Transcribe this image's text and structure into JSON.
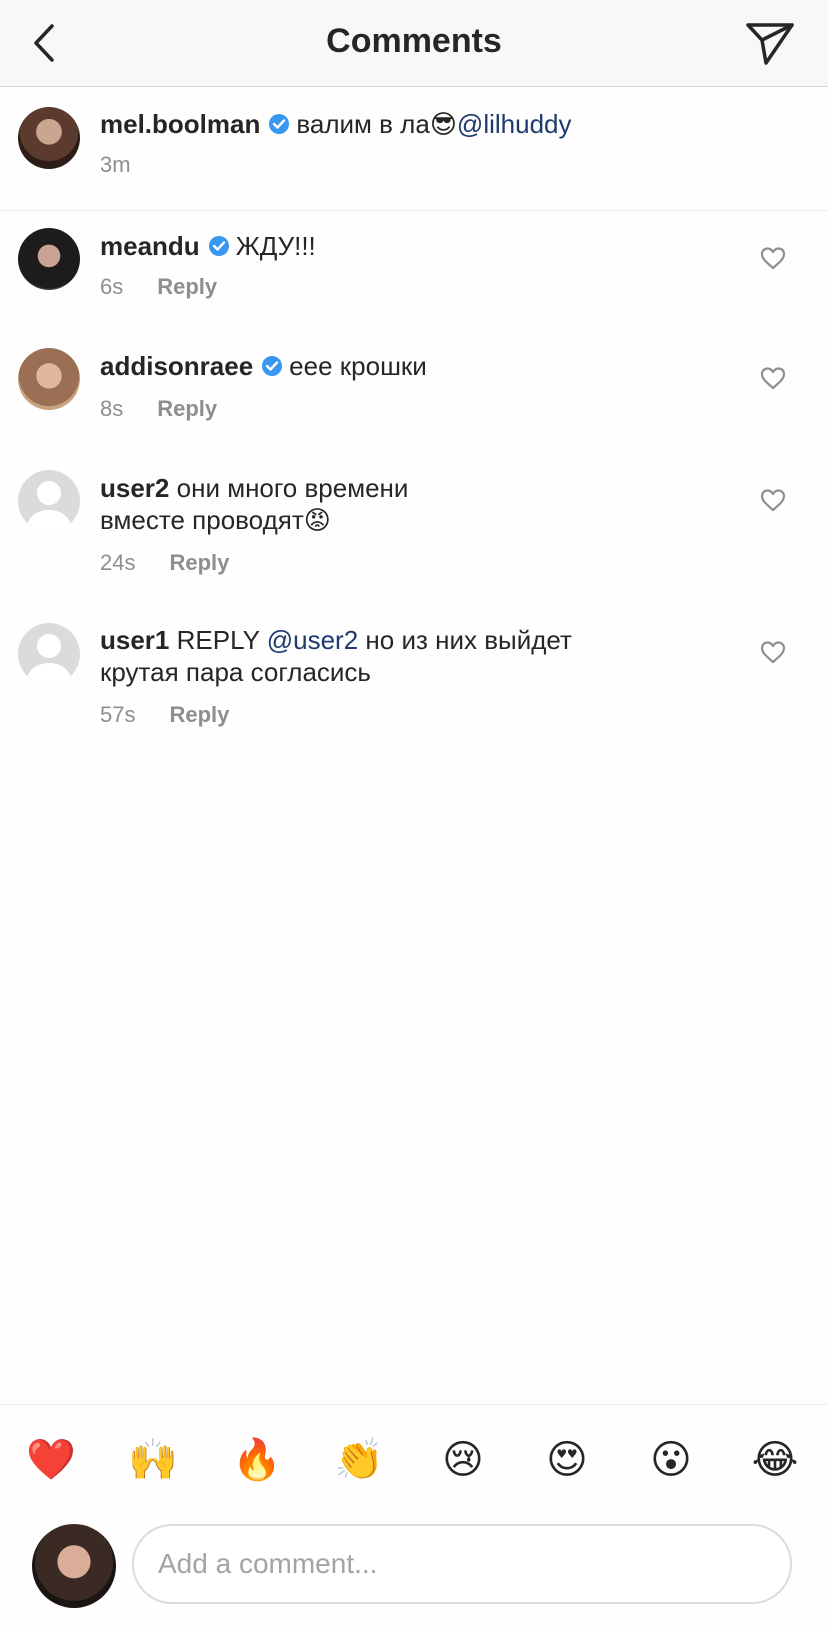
{
  "header": {
    "title": "Comments"
  },
  "caption": {
    "username": "mel.boolman",
    "text": "валим в ла",
    "emoji": "😎",
    "mention": "@lilhuddy",
    "time": "3m"
  },
  "comments": [
    {
      "username": "meandu",
      "verified": true,
      "text": "ЖДУ!!!",
      "time": "6s",
      "reply_label": "Reply"
    },
    {
      "username": "addisonraee",
      "verified": true,
      "text": "еее крошки",
      "time": "8s",
      "reply_label": "Reply"
    },
    {
      "username": "user2",
      "verified": false,
      "text_line1": "они много времени",
      "text_line2": "вместе проводят",
      "emoji": "😡",
      "time": "24s",
      "reply_label": "Reply"
    },
    {
      "username": "user1",
      "verified": false,
      "prefix": "REPLY",
      "mention": "@user2",
      "text_line1": "но из них выйдет",
      "text_line2": "крутая пара согласись",
      "time": "57s",
      "reply_label": "Reply"
    }
  ],
  "quick_reactions": [
    "❤️",
    "🙌",
    "🔥",
    "👏",
    "😢",
    "😍",
    "😮",
    "😂"
  ],
  "composer": {
    "placeholder": "Add a comment..."
  },
  "colors": {
    "verified": "#3897f0",
    "mention": "#1e3a6e",
    "meta": "#8e8e8e"
  }
}
